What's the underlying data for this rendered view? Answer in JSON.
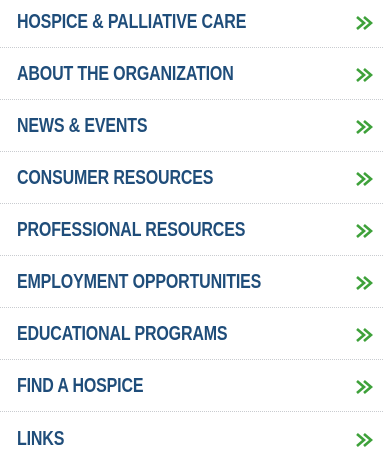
{
  "nav": {
    "items": [
      {
        "label": "HOSPICE & PALLIATIVE CARE",
        "icon": "double-chevron-right-icon"
      },
      {
        "label": "ABOUT THE ORGANIZATION",
        "icon": "double-chevron-right-icon"
      },
      {
        "label": "NEWS & EVENTS",
        "icon": "double-chevron-right-icon"
      },
      {
        "label": "CONSUMER RESOURCES",
        "icon": "double-chevron-right-icon"
      },
      {
        "label": "PROFESSIONAL RESOURCES",
        "icon": "double-chevron-right-icon"
      },
      {
        "label": "EMPLOYMENT OPPORTUNITIES",
        "icon": "double-chevron-right-icon"
      },
      {
        "label": "EDUCATIONAL PROGRAMS",
        "icon": "double-chevron-right-icon"
      },
      {
        "label": "FIND A HOSPICE",
        "icon": "double-chevron-right-icon"
      },
      {
        "label": "LINKS",
        "icon": "double-chevron-right-icon"
      }
    ]
  },
  "colors": {
    "label": "#1f4d7a",
    "arrow": "#3ea13a",
    "divider": "#c9ccd0"
  }
}
